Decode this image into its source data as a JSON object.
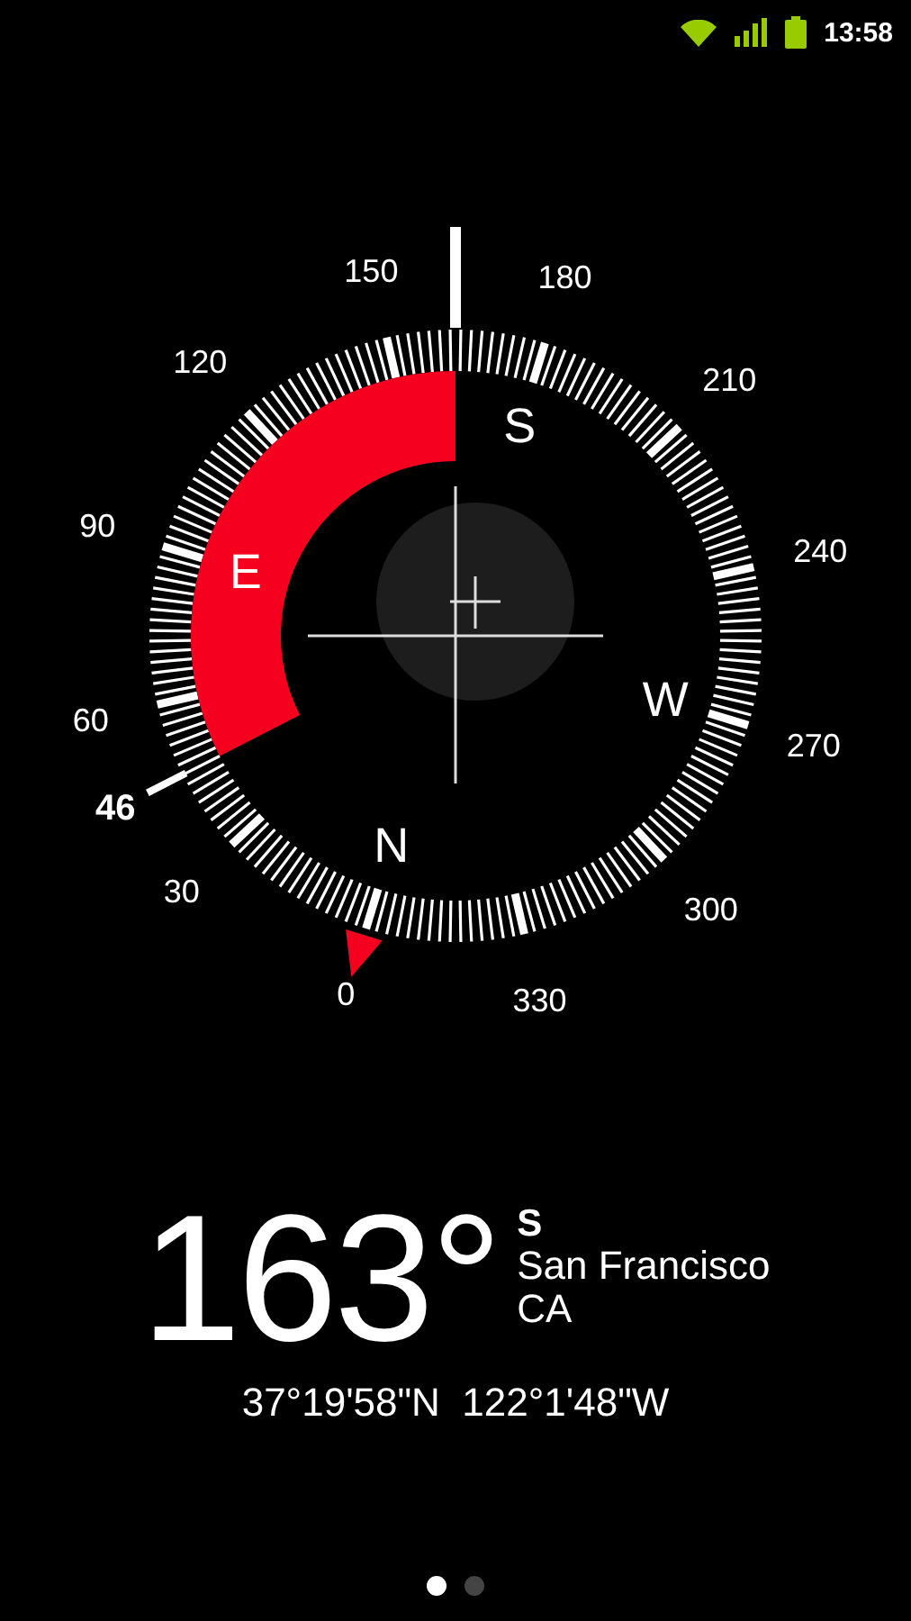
{
  "status_bar": {
    "time": "13:58"
  },
  "compass": {
    "bearing": "46",
    "dial_labels": [
      "0",
      "30",
      "60",
      "90",
      "120",
      "150",
      "180",
      "210",
      "240",
      "270",
      "300",
      "330"
    ],
    "cardinals": [
      "N",
      "E",
      "S",
      "W"
    ]
  },
  "readout": {
    "heading": "163°",
    "direction": "S",
    "city": "San Francisco",
    "region": "CA",
    "coordinates": "37°19'58\"N  122°1'48\"W"
  },
  "pages": [
    {
      "selected": true
    },
    {
      "selected": false
    }
  ]
}
